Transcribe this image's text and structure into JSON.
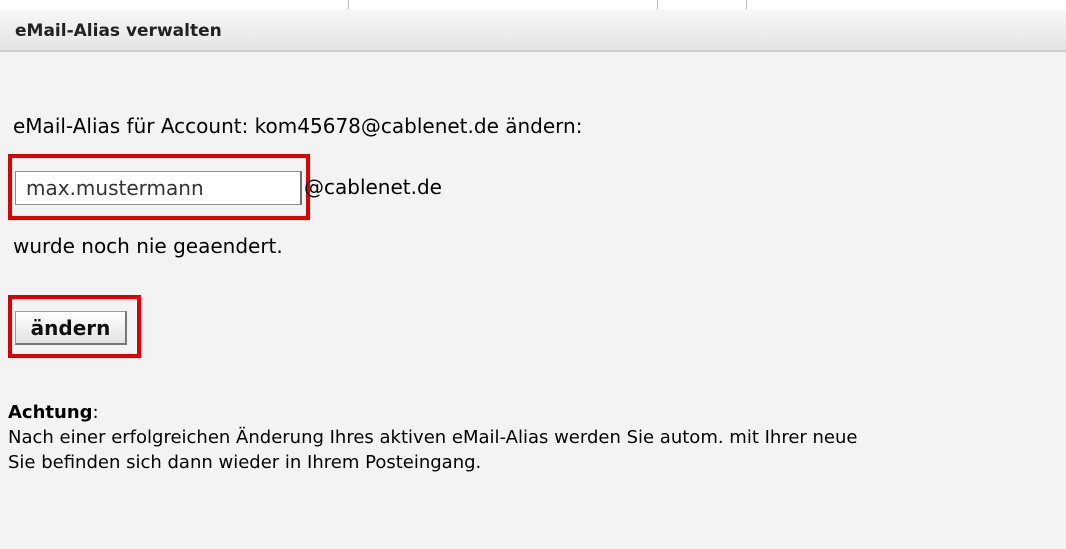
{
  "header": {
    "title": "eMail-Alias verwalten"
  },
  "form": {
    "account_text": "eMail-Alias für Account: kom45678@cablenet.de ändern:",
    "alias_value": "max.mustermann",
    "domain_suffix": "@cablenet.de",
    "status_text": "wurde noch nie geaendert.",
    "submit_label": "ändern"
  },
  "notice": {
    "heading": "Achtung",
    "colon": ":",
    "line1": "Nach einer erfolgreichen Änderung Ihres aktiven eMail-Alias werden Sie autom. mit Ihrer neue",
    "line2": "Sie befinden sich dann wieder in Ihrem Posteingang."
  },
  "colors": {
    "highlight": "#e00000",
    "background": "#f3f3f3"
  }
}
